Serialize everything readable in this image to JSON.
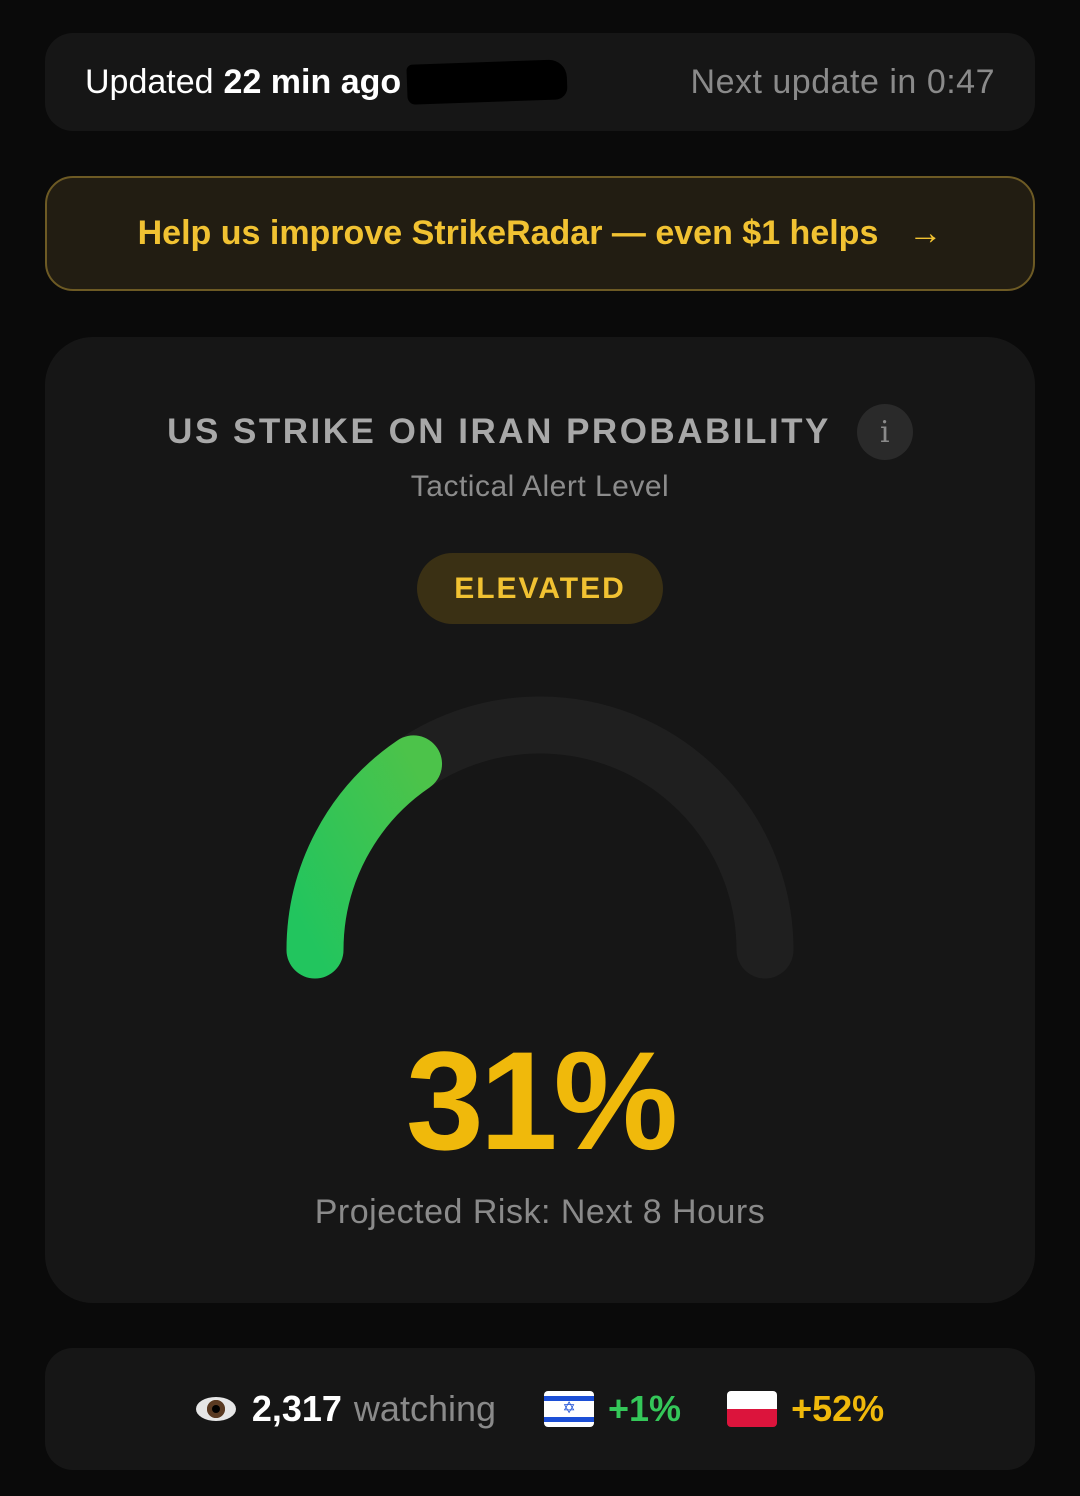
{
  "status": {
    "updated_prefix": "Updated",
    "updated_value": "22 min ago",
    "next_prefix": "Next update in",
    "next_value": "0:47"
  },
  "donate": {
    "label": "Help us improve StrikeRadar — even $1 helps",
    "arrow": "→",
    "color": "#f1c232"
  },
  "main": {
    "title": "US STRIKE ON IRAN PROBABILITY",
    "info_icon": "i",
    "subtitle": "Tactical Alert Level",
    "level": "ELEVATED",
    "probability": 31,
    "probability_text": "31%",
    "risk_label": "Projected Risk: Next 8 Hours",
    "gauge_colors": {
      "start": "#22c55e",
      "end": "#4cc34a",
      "track": "#1f1f1f"
    },
    "accent": "#f0b90b"
  },
  "stats": {
    "eye_icon": "eye-icon",
    "watching_count": "2,317",
    "watching_label": "watching",
    "flags": [
      {
        "flag": "israel-flag-icon",
        "delta": "+1%",
        "color": "#34c759"
      },
      {
        "flag": "poland-flag-icon",
        "delta": "+52%",
        "color": "#f0b90b"
      }
    ]
  }
}
